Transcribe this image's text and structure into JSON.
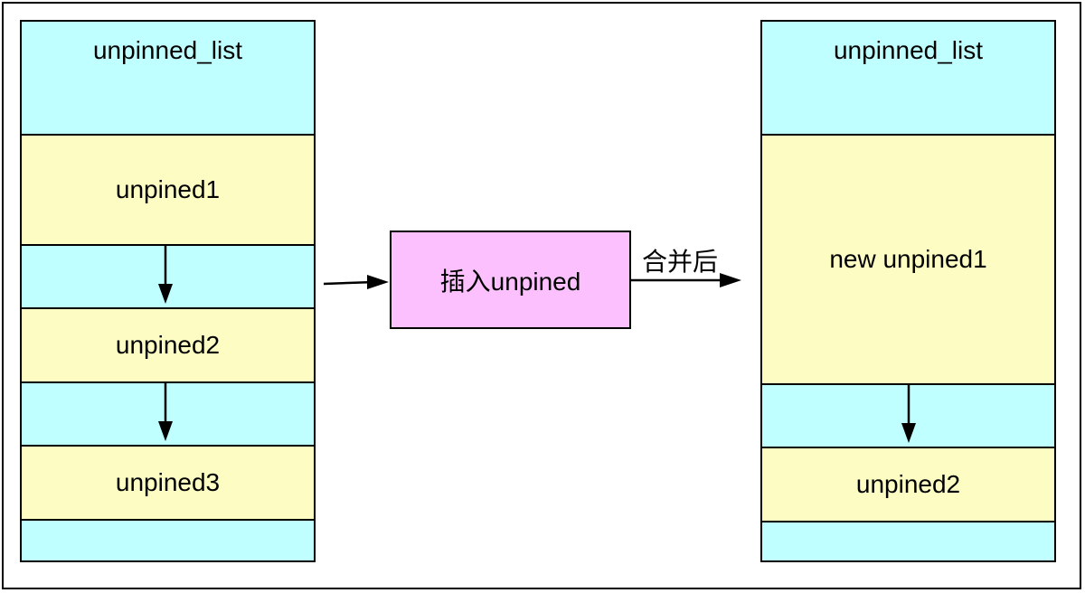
{
  "left_list": {
    "header": "unpinned_list",
    "items": [
      "unpined1",
      "unpined2",
      "unpined3"
    ]
  },
  "operation": {
    "label": "插入unpined",
    "result_label": "合并后"
  },
  "right_list": {
    "header": "unpinned_list",
    "items": [
      "new unpined1",
      "unpined2"
    ]
  },
  "colors": {
    "list_background": "#c0ffff",
    "item_background": "#fcfcc3",
    "operation_background": "#fbc0fd",
    "stroke": "#000000"
  }
}
